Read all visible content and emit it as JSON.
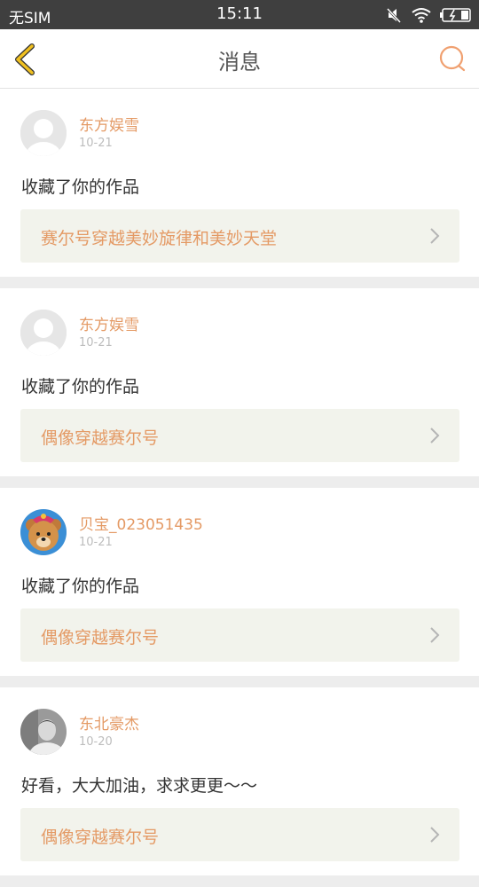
{
  "statusbar": {
    "carrier": "无SIM",
    "time": "15:11",
    "icons": [
      "mute-icon",
      "wifi-icon",
      "battery-icon"
    ]
  },
  "header": {
    "title": "消息",
    "back_icon": "chevron-left-icon",
    "search_icon": "search-icon"
  },
  "colors": {
    "accent": "#e49a65",
    "back_icon": "#f0c020",
    "search_icon": "#f0a070",
    "link_bg": "#f2f3ec"
  },
  "messages": [
    {
      "user": "东方娱雪",
      "date": "10-21",
      "text": "收藏了你的作品",
      "work": "赛尔号穿越美妙旋律和美妙天堂",
      "avatar": "default-avatar"
    },
    {
      "user": "东方娱雪",
      "date": "10-21",
      "text": "收藏了你的作品",
      "work": "偶像穿越赛尔号",
      "avatar": "default-avatar"
    },
    {
      "user": "贝宝_023051435",
      "date": "10-21",
      "text": "收藏了你的作品",
      "work": "偶像穿越赛尔号",
      "avatar": "bear-avatar"
    },
    {
      "user": "东北豪杰",
      "date": "10-20",
      "text": "好看，大大加油，求求更更～～",
      "work": "偶像穿越赛尔号",
      "avatar": "photo-avatar"
    }
  ]
}
